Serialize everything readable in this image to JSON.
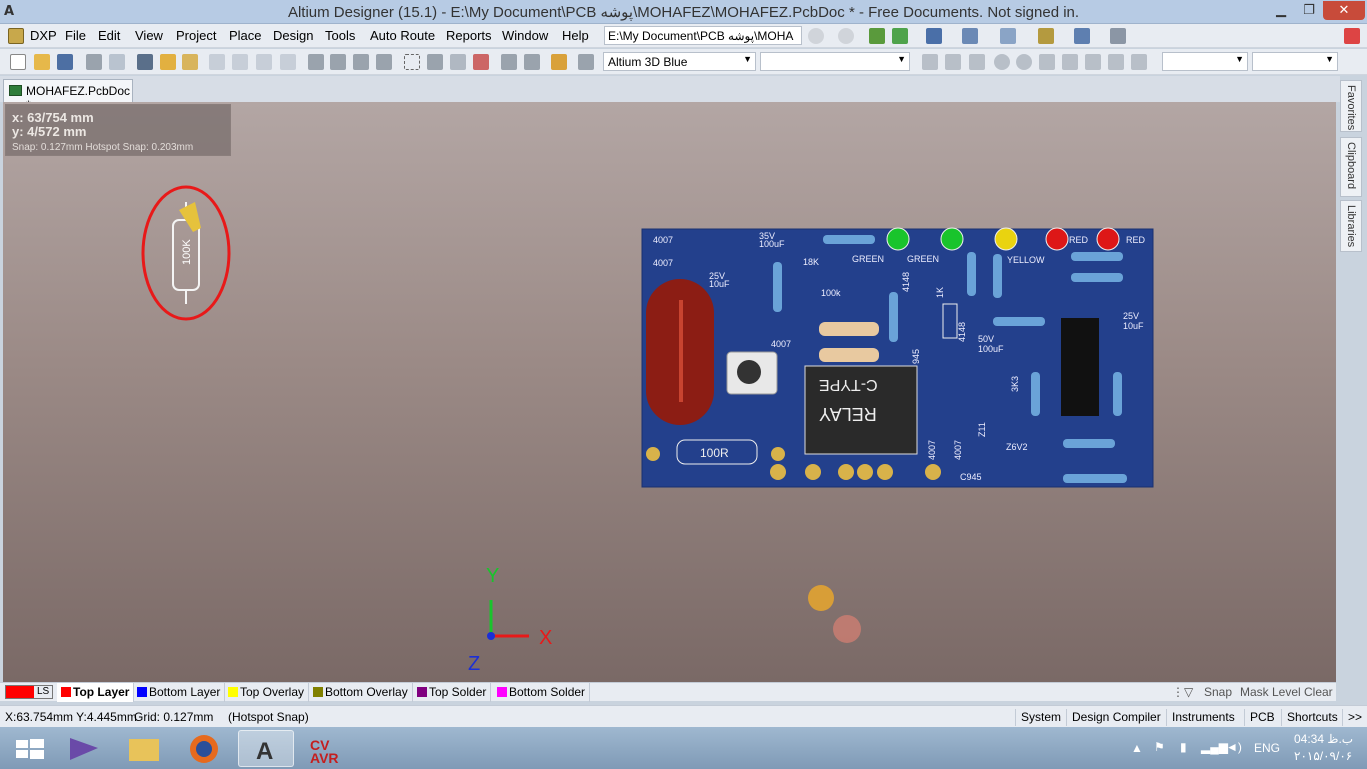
{
  "window": {
    "title": "Altium Designer (15.1) - E:\\My Document\\PCB پوشه\\MOHAFEZ\\MOHAFEZ.PcbDoc * - Free Documents. Not signed in.",
    "min_glyph": "▁",
    "max_glyph": "❐",
    "close_glyph": "✕"
  },
  "menu": {
    "items": [
      "DXP",
      "File",
      "Edit",
      "View",
      "Project",
      "Place",
      "Design",
      "Tools",
      "Auto Route",
      "Reports",
      "Window",
      "Help"
    ],
    "path_combo": "E:\\My Document\\PCB پوشه\\MOHA"
  },
  "toolbar": {
    "view_combo": "Altium 3D Blue",
    "combo2": "",
    "combo3": "",
    "combo4": ""
  },
  "document_tab": {
    "label": "MOHAFEZ.PcbDoc *"
  },
  "coords_overlay": {
    "x": "x: 63/754  mm",
    "y": "y:  4/572  mm",
    "snap": "Snap: 0.127mm Hotspot Snap: 0.203mm"
  },
  "floating_component": {
    "label": "100K"
  },
  "pcb": {
    "labels": {
      "d1": "4007",
      "d2": "4007",
      "c1": "35V",
      "c1b": "100uF",
      "c2": "25V",
      "c2b": "10uF",
      "r18k": "18K",
      "r100k": "100k",
      "green1": "GREEN",
      "green2": "GREEN",
      "yellow": "YELLOW",
      "red1": "RED",
      "red2": "RED",
      "d4148a": "4148",
      "r1k": "1K",
      "d4148b": "4148",
      "d4007c": "4007",
      "c50": "50V",
      "c50b": "100uF",
      "q945": "945",
      "z11": "Z11",
      "r3k3": "3K3",
      "c25": "25V",
      "c25b": "10uF",
      "relay1": "C-TYPE",
      "relay2": "RELAY",
      "r100r": "100R",
      "d4007d": "4007",
      "d4007e": "4007",
      "z6v2": "Z6V2",
      "c945": "C945"
    }
  },
  "axes": {
    "x": "X",
    "y": "Y",
    "z": "Z"
  },
  "side_panels": [
    "Favorites",
    "Clipboard",
    "Libraries"
  ],
  "layer_bar": {
    "ls": "LS",
    "layers": [
      {
        "name": "Top Layer",
        "color": "#ff0000"
      },
      {
        "name": "Bottom Layer",
        "color": "#0000ff"
      },
      {
        "name": "Top Overlay",
        "color": "#ffff00"
      },
      {
        "name": "Bottom Overlay",
        "color": "#808000"
      },
      {
        "name": "Top Solder",
        "color": "#800080"
      },
      {
        "name": "Bottom Solder",
        "color": "#ff00ff"
      }
    ],
    "snap": "Snap",
    "mask_level": "Mask Level",
    "clear": "Clear"
  },
  "status_bar": {
    "position": "X:63.754mm Y:4.445mm",
    "grid": "Grid: 0.127mm",
    "hotspot": "(Hotspot Snap)",
    "buttons": [
      "System",
      "Design Compiler",
      "Instruments",
      "PCB",
      "Shortcuts",
      ">>"
    ]
  },
  "taskbar": {
    "lang": "ENG",
    "time": "04:34 ب.ظ",
    "date": "۲۰۱۵/۰۹/۰۶"
  }
}
